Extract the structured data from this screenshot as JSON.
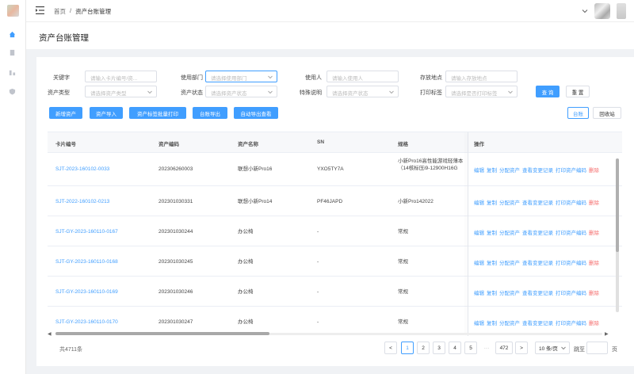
{
  "header": {
    "breadcrumb": [
      "首页",
      "/",
      "资产台账管理"
    ]
  },
  "page_title": "资产台账管理",
  "filters": {
    "keyword": {
      "label": "关键字",
      "placeholder": "请输入卡片编号/资..."
    },
    "department": {
      "label": "使用部门",
      "placeholder": "请选择使用部门"
    },
    "user": {
      "label": "使用人",
      "placeholder": "请输入使用人"
    },
    "location": {
      "label": "存放地点",
      "placeholder": "请输入存放地点"
    },
    "asset_type": {
      "label": "资产类型",
      "placeholder": "请选择资产类型"
    },
    "asset_status": {
      "label": "资产状态",
      "placeholder": "请选择资产状态"
    },
    "special_note": {
      "label": "特殊说明",
      "placeholder": "请选择资产状态"
    },
    "print_tag": {
      "label": "打印标签",
      "placeholder": "请选择是否打印标签"
    },
    "search_label": "查 询",
    "reset_label": "重 置"
  },
  "toolbar": {
    "add": "新增资产",
    "import": "资产导入",
    "batch_print": "资产标签批量打印",
    "export": "台账导出",
    "auto_export": "自动导出查看",
    "view_ledger": "台账",
    "view_recycle": "回收站"
  },
  "table": {
    "headers": [
      "卡片编号",
      "资产编码",
      "资产名称",
      "SN",
      "规格",
      "操作"
    ],
    "actions": [
      "编辑",
      "复制",
      "分配资产",
      "查看变更记录",
      "打印资产编码",
      "删除"
    ],
    "rows": [
      {
        "card_no": "SJT-2023-160102-0033",
        "code": "202306260003",
        "name": "联想小新Pro16",
        "sn": "YXO5TY7A",
        "spec": "小新Pro16高性能游戏轻薄本（14核标压i9-12900H16G"
      },
      {
        "card_no": "SJT-2022-160102-0213",
        "code": "202301030331",
        "name": "联想小新Pro14",
        "sn": "PF46JAPD",
        "spec": "小新Pro142022"
      },
      {
        "card_no": "SJT-GY-2023-160110-0167",
        "code": "202301030244",
        "name": "办公椅",
        "sn": "-",
        "spec": "常规"
      },
      {
        "card_no": "SJT-GY-2023-160110-0168",
        "code": "202301030245",
        "name": "办公椅",
        "sn": "-",
        "spec": "常规"
      },
      {
        "card_no": "SJT-GY-2023-160110-0169",
        "code": "202301030246",
        "name": "办公椅",
        "sn": "-",
        "spec": "常规"
      },
      {
        "card_no": "SJT-GY-2023-160110-0170",
        "code": "202301030247",
        "name": "办公椅",
        "sn": "-",
        "spec": "常规"
      }
    ]
  },
  "pagination": {
    "total": "共4711条",
    "prev": "<",
    "pages": [
      "1",
      "2",
      "3",
      "4",
      "5"
    ],
    "more": "···",
    "last": "472",
    "next": ">",
    "page_size": "10 条/页",
    "goto_prefix": "跳至",
    "goto_suffix": "页"
  },
  "colors": {
    "primary": "#409eff",
    "danger": "#f56c6c"
  }
}
